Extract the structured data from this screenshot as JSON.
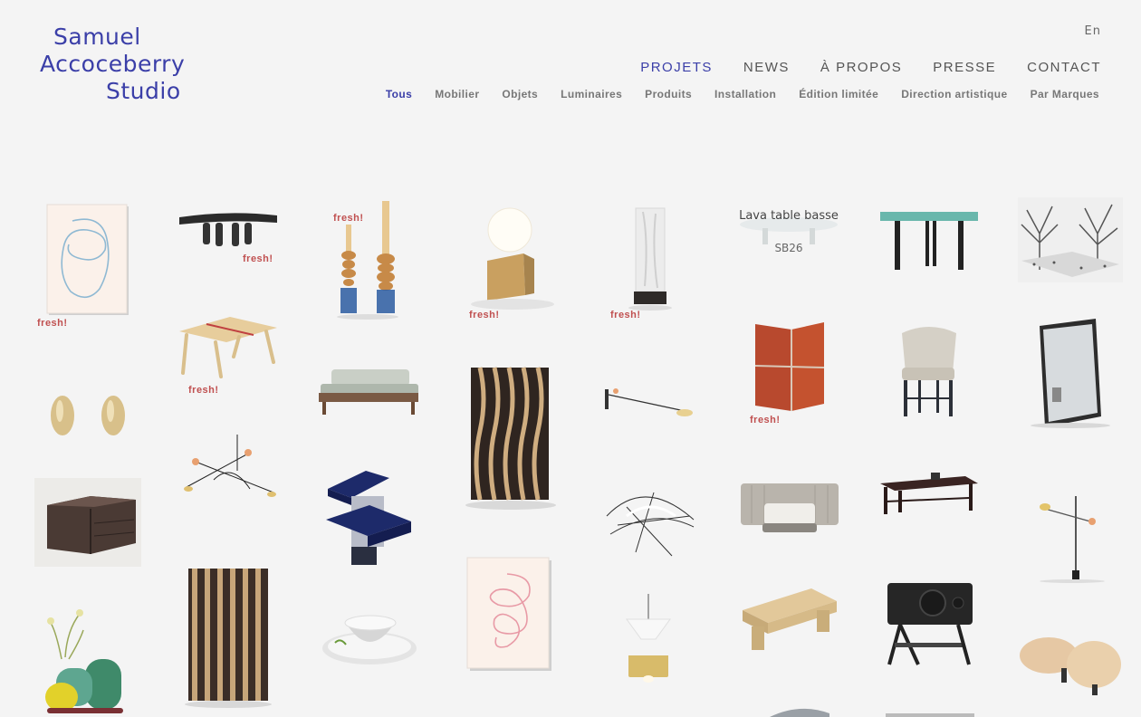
{
  "logo": {
    "line1": "Samuel",
    "line2": "Accoceberry",
    "line3": "Studio"
  },
  "lang": "En",
  "main_nav": [
    {
      "label": "PROJETS",
      "active": true
    },
    {
      "label": "NEWS",
      "active": false
    },
    {
      "label": "À PROPOS",
      "active": false
    },
    {
      "label": "PRESSE",
      "active": false
    },
    {
      "label": "CONTACT",
      "active": false
    }
  ],
  "sub_nav": [
    {
      "label": "Tous",
      "active": true
    },
    {
      "label": "Mobilier",
      "active": false
    },
    {
      "label": "Objets",
      "active": false
    },
    {
      "label": "Luminaires",
      "active": false
    },
    {
      "label": "Produits",
      "active": false
    },
    {
      "label": "Installation",
      "active": false
    },
    {
      "label": "Édition limitée",
      "active": false
    },
    {
      "label": "Direction artistique",
      "active": false
    },
    {
      "label": "Par Marques",
      "active": false
    }
  ],
  "fresh_label": "fresh!",
  "hovered_project": {
    "title": "Lava table basse",
    "code": "SB26"
  },
  "colors": {
    "accent": "#3b3fa8",
    "fresh": "#c05050",
    "background": "#f4f4f4"
  }
}
